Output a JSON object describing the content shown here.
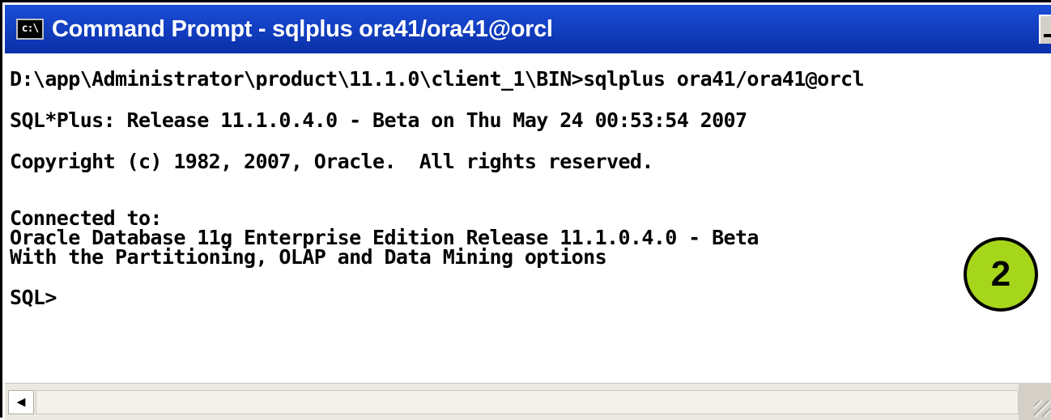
{
  "window": {
    "title": "Command Prompt - sqlplus ora41/ora41@orcl",
    "icon_name": "cmd-console-icon",
    "icon_glyph": "c:\\"
  },
  "console": {
    "lines": [
      "D:\\app\\Administrator\\product\\11.1.0\\client_1\\BIN>sqlplus ora41/ora41@orcl",
      "SQL*Plus: Release 11.1.0.4.0 - Beta on Thu May 24 00:53:54 2007",
      "Copyright (c) 1982, 2007, Oracle.  All rights reserved.",
      "Connected to:",
      "Oracle Database 11g Enterprise Edition Release 11.1.0.4.0 - Beta",
      "With the Partitioning, OLAP and Data Mining options",
      "SQL>"
    ]
  },
  "annotation": {
    "step_number": "2",
    "color": "#a6d61c"
  },
  "scrollbar": {
    "left_arrow_icon": "scroll-left-arrow-icon",
    "left_arrow_glyph": "◀"
  }
}
